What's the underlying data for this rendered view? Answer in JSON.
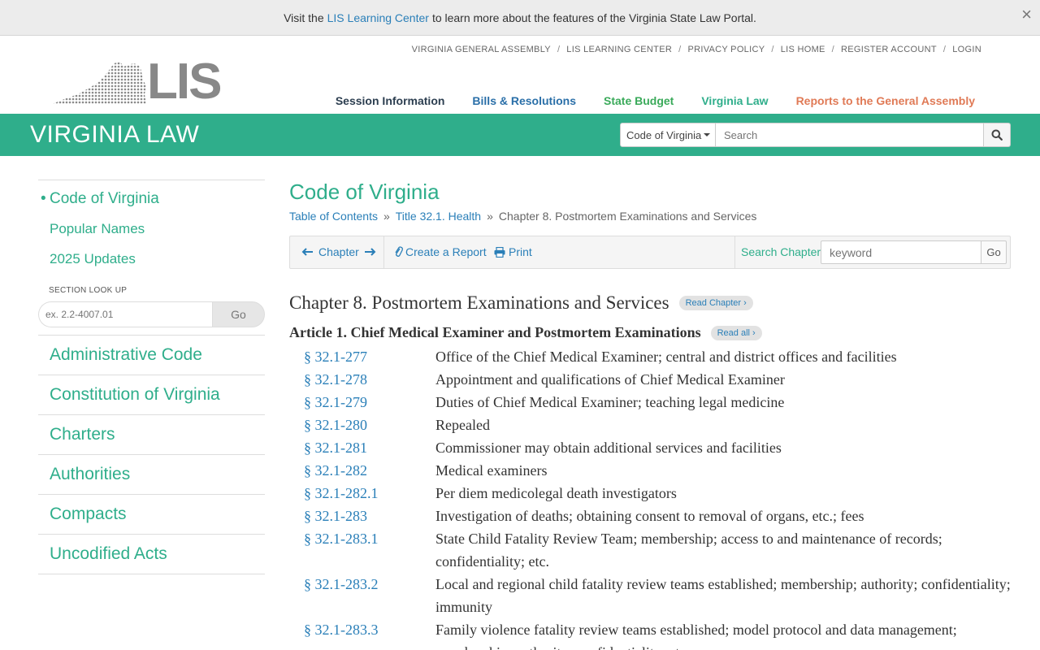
{
  "announcement": {
    "prefix": "Visit the",
    "link": "LIS Learning Center",
    "suffix": "to learn more about the features of the Virginia State Law Portal.",
    "close": "×"
  },
  "header": {
    "logo_text": "LIS",
    "top_nav": [
      "VIRGINIA GENERAL ASSEMBLY",
      "LIS LEARNING CENTER",
      "PRIVACY POLICY",
      "LIS HOME",
      "REGISTER ACCOUNT",
      "LOGIN"
    ],
    "top_nav_separator": "/",
    "main_nav": [
      {
        "label": "Session Information",
        "color": "#2c3e50"
      },
      {
        "label": "Bills & Resolutions",
        "color": "#2a6fa8"
      },
      {
        "label": "State Budget",
        "color": "#3aaa5a"
      },
      {
        "label": "Virginia Law",
        "color": "#2fae8b"
      },
      {
        "label": "Reports to the General Assembly",
        "color": "#e07a56"
      }
    ]
  },
  "band": {
    "title": "VIRGINIA LAW",
    "color": "#2fae8b",
    "search_scope": "Code of Virginia",
    "search_placeholder": "Search"
  },
  "sidebar": {
    "active": "Code of Virginia",
    "sub_items": [
      "Popular Names",
      "2025 Updates"
    ],
    "lookup_label": "SECTION LOOK UP",
    "lookup_placeholder": "ex. 2.2-4007.01",
    "lookup_button": "Go",
    "items": [
      "Administrative Code",
      "Constitution of Virginia",
      "Charters",
      "Authorities",
      "Compacts",
      "Uncodified Acts"
    ]
  },
  "main": {
    "title": "Code of Virginia",
    "breadcrumbs": [
      "Table of Contents",
      "Title 32.1. Health",
      "Chapter 8. Postmortem Examinations and Services"
    ],
    "breadcrumb_separator": "»",
    "toolbar": {
      "chapter": "Chapter",
      "create_report": "Create a Report",
      "print": "Print",
      "search_label": "Search Chapter",
      "search_placeholder": "keyword",
      "go": "Go"
    },
    "chapter_heading": "Chapter 8. Postmortem Examinations and Services",
    "read_chapter": "Read Chapter ›",
    "article_heading": "Article 1. Chief Medical Examiner and Postmortem Examinations",
    "read_all": "Read all ›",
    "sections": [
      {
        "num": "§ 32.1-277",
        "title": "Office of the Chief Medical Examiner; central and district offices and facilities"
      },
      {
        "num": "§ 32.1-278",
        "title": "Appointment and qualifications of Chief Medical Examiner"
      },
      {
        "num": "§ 32.1-279",
        "title": "Duties of Chief Medical Examiner; teaching legal medicine"
      },
      {
        "num": "§ 32.1-280",
        "title": "Repealed"
      },
      {
        "num": "§ 32.1-281",
        "title": "Commissioner may obtain additional services and facilities"
      },
      {
        "num": "§ 32.1-282",
        "title": "Medical examiners"
      },
      {
        "num": "§ 32.1-282.1",
        "title": "Per diem medicolegal death investigators"
      },
      {
        "num": "§ 32.1-283",
        "title": "Investigation of deaths; obtaining consent to removal of organs, etc.; fees"
      },
      {
        "num": "§ 32.1-283.1",
        "title": "State Child Fatality Review Team; membership; access to and maintenance of records; confidentiality; etc."
      },
      {
        "num": "§ 32.1-283.2",
        "title": "Local and regional child fatality review teams established; membership; authority; confidentiality; immunity"
      },
      {
        "num": "§ 32.1-283.3",
        "title": "Family violence fatality review teams established; model protocol and data management; membership; authority; confidentiality; etc."
      }
    ]
  }
}
